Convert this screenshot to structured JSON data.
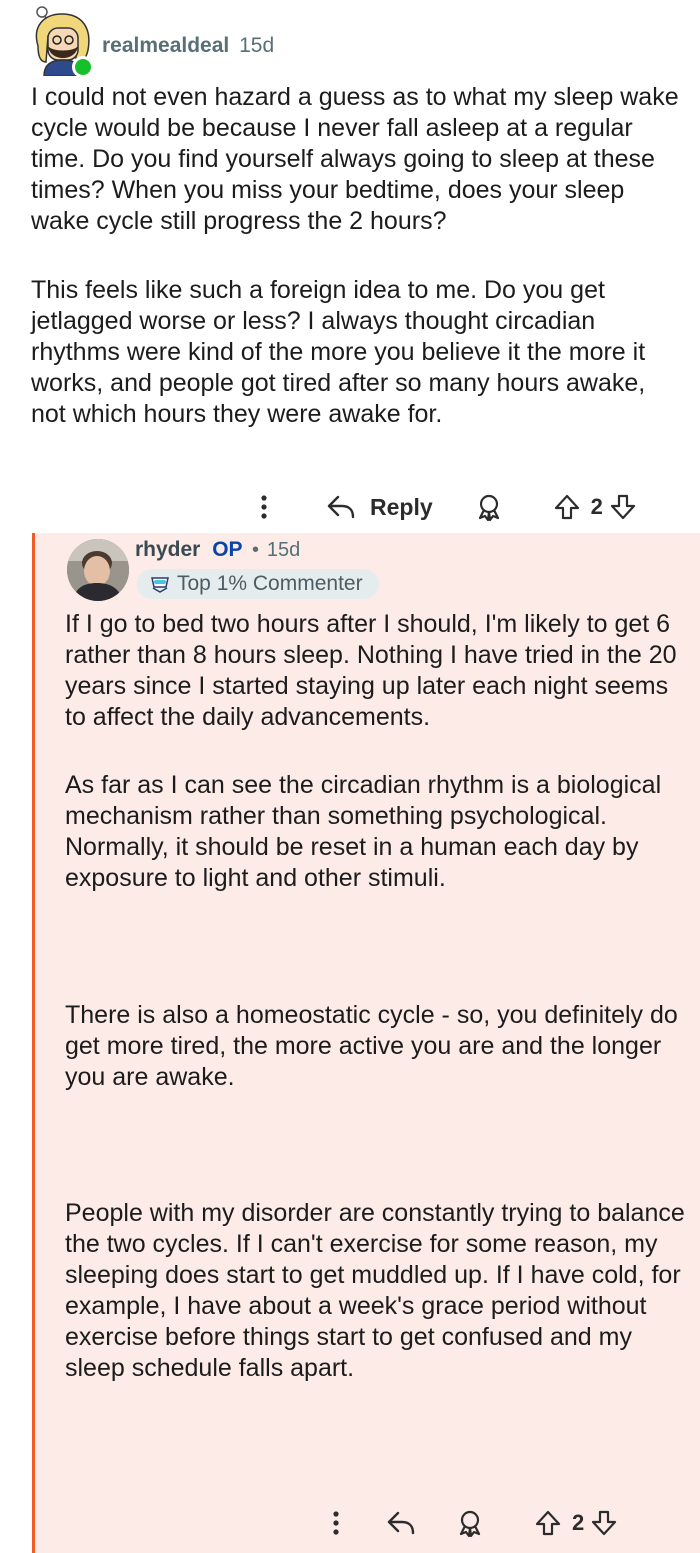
{
  "parent": {
    "author": "realmealdeal",
    "time": "15d",
    "paragraphs": [
      "I could not even hazard a guess as to what my sleep wake cycle would be because I never fall asleep at a regular time. Do you find yourself always going to sleep at these times? When you miss your bedtime, does your sleep wake cycle still progress the 2 hours?",
      "This feels like such a foreign idea to me. Do you get jetlagged worse or less? I always thought circadian rhythms were kind of the more you believe it the more it works, and people got tired after so many hours awake, not which hours they were awake for."
    ],
    "actions": {
      "reply_label": "Reply",
      "vote_count": "2"
    }
  },
  "reply": {
    "author": "rhyder",
    "op_label": "OP",
    "separator": "•",
    "time": "15d",
    "flair": "Top 1% Commenter",
    "paragraphs": [
      "If I go to bed two hours after I should, I'm likely to get 6 rather than 8 hours sleep. Nothing I have tried in the 20 years since I started staying up later each night seems to affect the daily advancements.",
      "As far as I can see the circadian rhythm is a biological mechanism rather than something psychological. Normally, it should be reset in a human each day by exposure to light and other stimuli.",
      "There is also a homeostatic cycle - so, you definitely do get more tired, the more active you are and the longer you are awake.",
      "People with my disorder are constantly trying to balance the two cycles. If I can't exercise for some reason, my sleeping does start to get muddled up. If I have cold, for example, I have about a week's grace period without exercise before things start to get confused and my sleep schedule falls apart."
    ],
    "actions": {
      "vote_count": "2"
    }
  },
  "icons": {
    "more": "more-vertical-icon",
    "reply": "reply-arrow-icon",
    "award": "award-icon",
    "upvote": "upvote-arrow-icon",
    "downvote": "downvote-arrow-icon",
    "flair": "commenter-badge-icon"
  },
  "colors": {
    "accent_line": "#f15c26",
    "reply_background": "#fcebe7",
    "op_badge": "#0a45a8",
    "online": "#15c02a"
  }
}
